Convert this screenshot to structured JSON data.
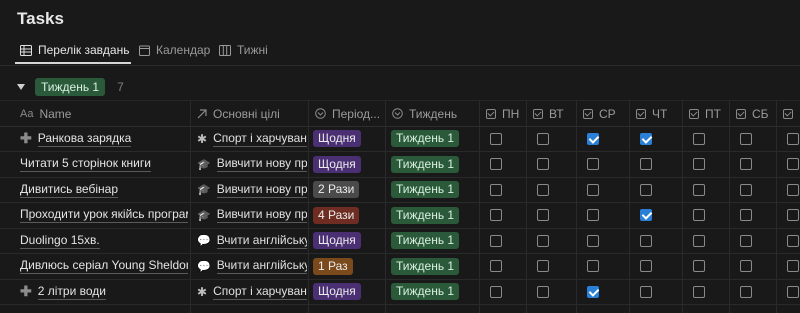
{
  "page": {
    "title": "Tasks"
  },
  "tabs": [
    {
      "label": "Перелік завдань",
      "icon": "table-icon",
      "active": true
    },
    {
      "label": "Календар",
      "icon": "calendar-icon",
      "active": false
    },
    {
      "label": "Тижні",
      "icon": "board-icon",
      "active": false
    }
  ],
  "group": {
    "label": "Тиждень 1",
    "count": "7"
  },
  "columns": {
    "name": "Name",
    "name_prefix": "Aa",
    "goals": "Основні цілі",
    "period": "Період...",
    "week": "Тиждень",
    "days": [
      "ПН",
      "ВТ",
      "СР",
      "ЧТ",
      "ПТ",
      "СБ"
    ]
  },
  "colors": {
    "bg": "#191919",
    "checkbox_checked": "#2a7fd6",
    "period_daily": "#4b2f73",
    "period_2x": "#4a4a4a",
    "period_4x": "#6e2c22",
    "period_1x": "#7a4a1c",
    "week_badge": "#2b5a3a"
  },
  "rows": [
    {
      "name": "Ранкова зарядка",
      "has_icon": true,
      "goal": "Спорт і харчування",
      "goal_icon": "asterisk-icon",
      "period": "Щодня",
      "period_color": "#4b2f73",
      "week": "Тиждень 1",
      "days": [
        false,
        false,
        true,
        true,
        false,
        false,
        false
      ]
    },
    {
      "name": "Читати 5 сторінок книги",
      "has_icon": false,
      "goal": "Вивчити нову професію",
      "goal_icon": "graduation-cap-icon",
      "period": "Щодня",
      "period_color": "#4b2f73",
      "week": "Тиждень 1",
      "days": [
        false,
        false,
        false,
        false,
        false,
        false,
        false
      ]
    },
    {
      "name": "Дивитись вебінар",
      "has_icon": false,
      "goal": "Вивчити нову професію",
      "goal_icon": "graduation-cap-icon",
      "period": "2 Рази",
      "period_color": "#4a4a4a",
      "week": "Тиждень 1",
      "days": [
        false,
        false,
        false,
        false,
        false,
        false,
        false
      ]
    },
    {
      "name": "Проходити урок якійсь програми",
      "has_icon": false,
      "goal": "Вивчити нову професію",
      "goal_icon": "graduation-cap-icon",
      "period": "4 Рази",
      "period_color": "#6e2c22",
      "week": "Тиждень 1",
      "days": [
        false,
        false,
        false,
        true,
        false,
        false,
        false
      ]
    },
    {
      "name": "Duolingo 15хв.",
      "has_icon": false,
      "goal": "Вчити англійську",
      "goal_icon": "chat-bubbles-icon",
      "period": "Щодня",
      "period_color": "#4b2f73",
      "week": "Тиждень 1",
      "days": [
        false,
        false,
        false,
        false,
        false,
        false,
        false
      ]
    },
    {
      "name": "Дивлюсь серіал Young Sheldon",
      "has_icon": false,
      "goal": "Вчити англійську",
      "goal_icon": "chat-bubbles-icon",
      "period": "1 Раз",
      "period_color": "#7a4a1c",
      "week": "Тиждень 1",
      "days": [
        false,
        false,
        false,
        false,
        false,
        false,
        false
      ]
    },
    {
      "name": "2 літри води",
      "has_icon": true,
      "goal": "Спорт і харчування",
      "goal_icon": "asterisk-icon",
      "period": "Щодня",
      "period_color": "#4b2f73",
      "week": "Тиждень 1",
      "days": [
        false,
        false,
        true,
        false,
        false,
        false,
        false
      ]
    }
  ]
}
